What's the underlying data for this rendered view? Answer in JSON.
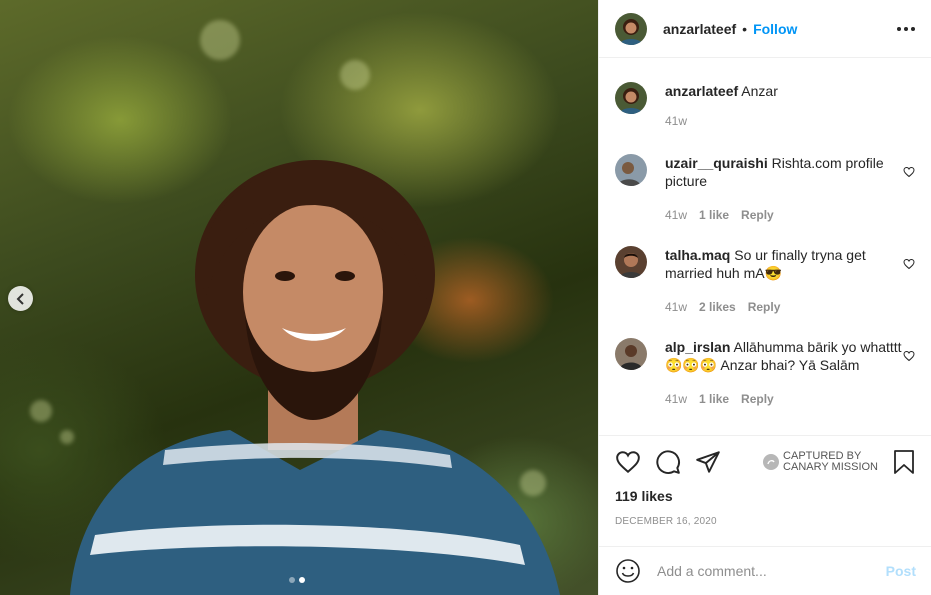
{
  "post": {
    "author": "anzarlateef",
    "follow_label": "Follow",
    "separator": "•",
    "caption_user": "anzarlateef",
    "caption_text": "Anzar",
    "caption_age": "41w"
  },
  "comments": [
    {
      "user": "uzair__quraishi",
      "text": "Rishta.com profile picture",
      "age": "41w",
      "likes": "1 like",
      "reply": "Reply"
    },
    {
      "user": "talha.maq",
      "text": "So ur finally tryna get married huh mA",
      "emoji": "😎",
      "age": "41w",
      "likes": "2 likes",
      "reply": "Reply"
    },
    {
      "user": "alp_irslan",
      "text": "Allāhumma bārik yo whatttt",
      "emoji": "😳😳😳",
      "text_after": "Anzar bhai? Yā Salām",
      "age": "41w",
      "likes": "1 like",
      "reply": "Reply"
    }
  ],
  "watermark": {
    "line1": "CAPTURED BY",
    "line2": "CANARY MISSION"
  },
  "stats": {
    "likes": "119 likes",
    "date": "DECEMBER 16, 2020"
  },
  "composer": {
    "placeholder": "Add a comment...",
    "post_label": "Post"
  },
  "carousel": {
    "count": 2,
    "active_index": 1
  },
  "colors": {
    "accent": "#0095f6",
    "post_disabled": "#b2dffc",
    "muted": "#8e8e8e"
  }
}
